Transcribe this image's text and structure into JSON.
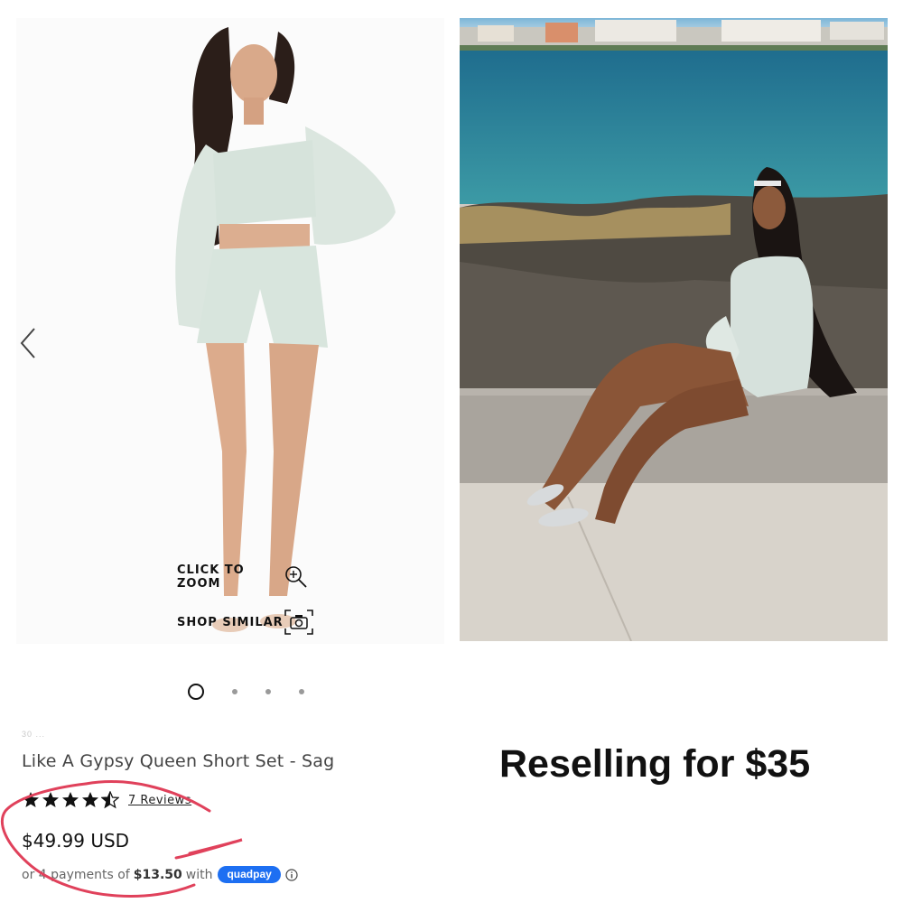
{
  "product_image": {
    "zoom_label": "CLICK TO ZOOM",
    "shop_similar_label": "SHOP SIMILAR",
    "icons": {
      "prev": "chevron-left-icon",
      "zoom": "magnifier-plus-icon",
      "camera": "camera-icon"
    }
  },
  "carousel": {
    "total": 4,
    "active": 1
  },
  "product": {
    "sku_faint": "30 ...",
    "title": "Like A Gypsy Queen Short Set - Sag",
    "rating": 4.5,
    "reviews_label": "7 Reviews",
    "price": "$49.99 USD",
    "payments_prefix": "or 4 payments of",
    "payment_amount": "$13.50",
    "payments_with": "with",
    "quadpay_label": "quadpay"
  },
  "overlay_text": "Reselling for $35",
  "colors": {
    "accent_blue": "#1d6ff2",
    "scribble_red": "#e0415b",
    "star": "#111111"
  }
}
